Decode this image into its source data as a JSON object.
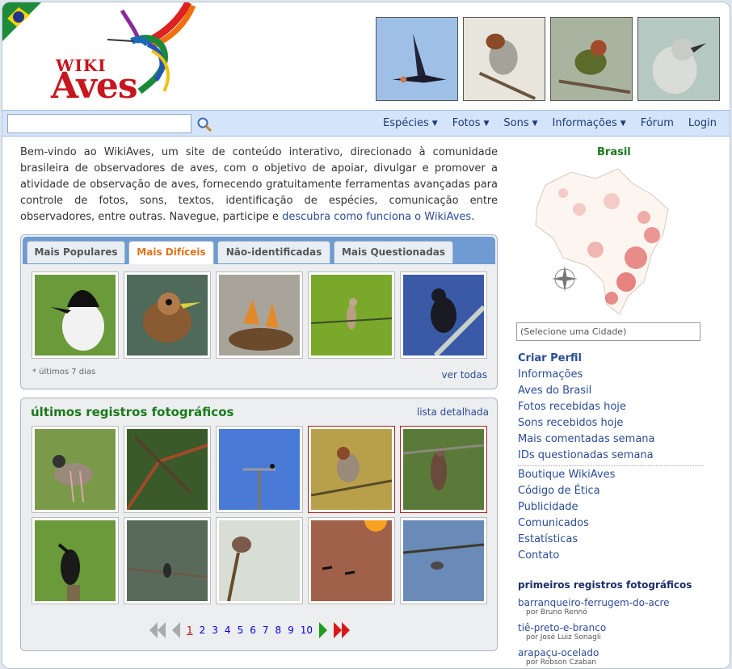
{
  "header": {
    "logo_wiki": "WIKI",
    "logo_aves": "Aves"
  },
  "nav": {
    "search_placeholder": "",
    "items": [
      {
        "label": "Espécies",
        "dropdown": true
      },
      {
        "label": "Fotos",
        "dropdown": true
      },
      {
        "label": "Sons",
        "dropdown": true
      },
      {
        "label": "Informações",
        "dropdown": true
      },
      {
        "label": "Fórum",
        "dropdown": false
      },
      {
        "label": "Login",
        "dropdown": false
      }
    ]
  },
  "intro": {
    "text": "Bem-vindo ao WikiAves, um site de conteúdo interativo, direcionado à comunidade brasileira de observadores de aves, com o objetivo de apoiar, divulgar e promover a atividade de observação de aves, fornecendo gratuitamente ferramentas avançadas para controle de fotos, sons, textos, identificação de espécies, comunicação entre observadores, entre outras. Navegue, participe e ",
    "link": "descubra como funciona o WikiAves",
    "end": "."
  },
  "tabs": {
    "items": [
      "Mais Populares",
      "Mais Difíceis",
      "Não-identificadas",
      "Mais Questionadas"
    ],
    "active": 1,
    "note": "* últimos 7 dias",
    "see_all": "ver todas"
  },
  "recent": {
    "title": "últimos registros fotográficos",
    "detail_link": "lista detalhada",
    "pages": [
      "1",
      "2",
      "3",
      "4",
      "5",
      "6",
      "7",
      "8",
      "9",
      "10"
    ],
    "current_page": "1"
  },
  "sidebar": {
    "map_title": "Brasil",
    "city_placeholder": "(Selecione uma Cidade)",
    "menu1": [
      "Criar Perfil",
      "Informações",
      "Aves do Brasil",
      "Fotos recebidas hoje",
      "Sons recebidos hoje",
      "Mais comentadas semana",
      "IDs questionadas semana"
    ],
    "menu2": [
      "Boutique WikiAves",
      "Código de Ética",
      "Publicidade",
      "Comunicados",
      "Estatísticas",
      "Contato"
    ],
    "first_title": "primeiros registros fotográficos",
    "first_records": [
      {
        "name": "barranqueiro-ferrugem-do-acre",
        "by": "por Bruno Rennó"
      },
      {
        "name": "tiê-preto-e-branco",
        "by": "por José Luiz Sonagli"
      },
      {
        "name": "arapaçu-ocelado",
        "by": "por Robson Czaban"
      }
    ]
  },
  "colors": {
    "nav_bg": "#d4e4fa",
    "link": "#2a4c94",
    "green_title": "#1b7a1b",
    "active_tab": "#e0741a",
    "logo_red": "#c6161e"
  }
}
